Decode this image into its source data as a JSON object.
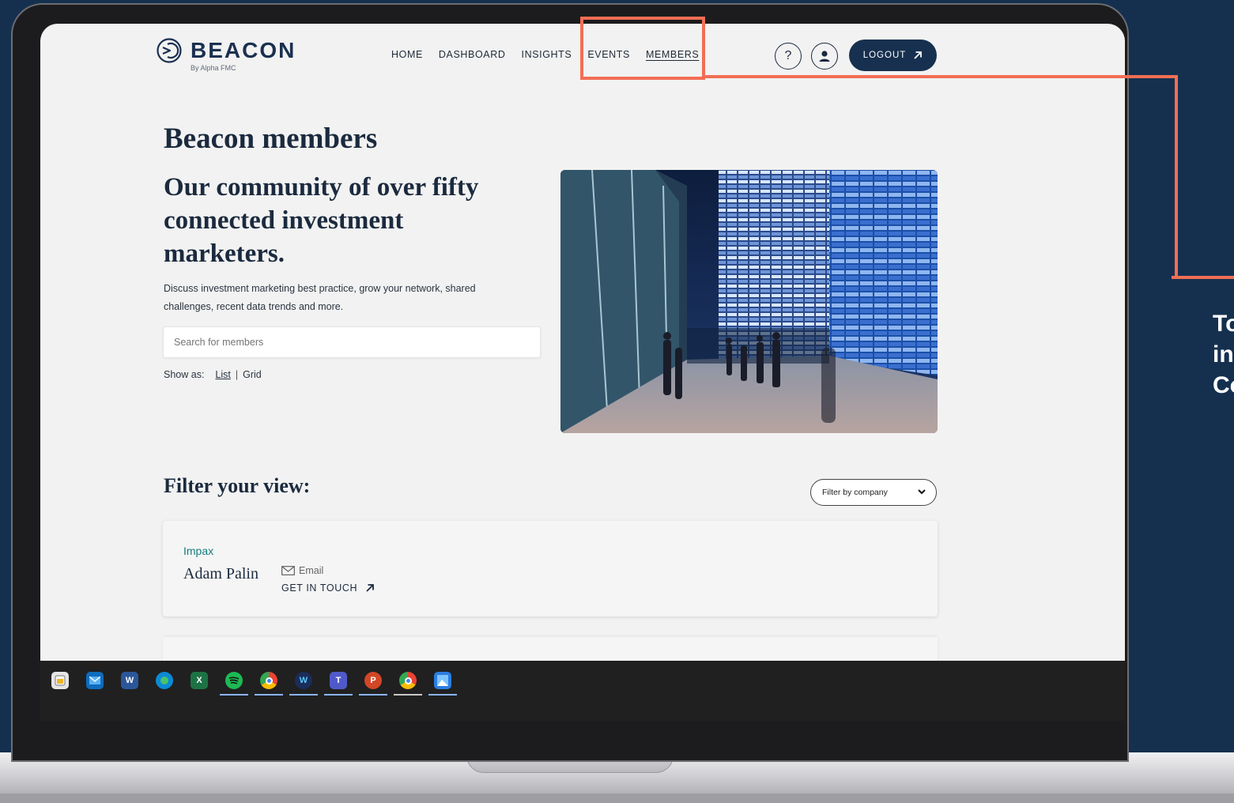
{
  "header": {
    "brand": "BEACON",
    "brand_sub": "By Alpha FMC",
    "nav": [
      {
        "label": "HOME",
        "active": false
      },
      {
        "label": "DASHBOARD",
        "active": false
      },
      {
        "label": "INSIGHTS",
        "active": false
      },
      {
        "label": "EVENTS",
        "active": false
      },
      {
        "label": "MEMBERS",
        "active": true
      }
    ],
    "help_symbol": "?",
    "logout_label": "LOGOUT"
  },
  "hero": {
    "title": "Beacon members",
    "tagline": "Our community of over fifty connected investment marketers.",
    "description": "Discuss investment marketing best practice, grow your network, shared challenges, recent data trends and more.",
    "search_placeholder": "Search for members",
    "show_as_label": "Show as:",
    "view_list": "List",
    "view_grid": "Grid"
  },
  "filter": {
    "title": "Filter your view:",
    "select_value": "Filter by company"
  },
  "members": [
    {
      "company": "Impax",
      "name": "Adam Palin",
      "email_label": "Email",
      "cta_label": "GET IN TOUCH"
    }
  ],
  "taskbar": {
    "apps": [
      "start-icon",
      "mail-icon",
      "word-icon",
      "edge-icon",
      "excel-icon",
      "spotify-icon",
      "chrome-icon",
      "webex-icon",
      "teams-icon",
      "powerpoint-icon",
      "chrome-profile-icon",
      "photos-icon"
    ]
  },
  "callout": {
    "lines": [
      "To",
      "in",
      "Co"
    ]
  },
  "colors": {
    "navy": "#17304f",
    "accent": "#f26e55",
    "teal": "#197c7c",
    "background": "#15304f"
  }
}
